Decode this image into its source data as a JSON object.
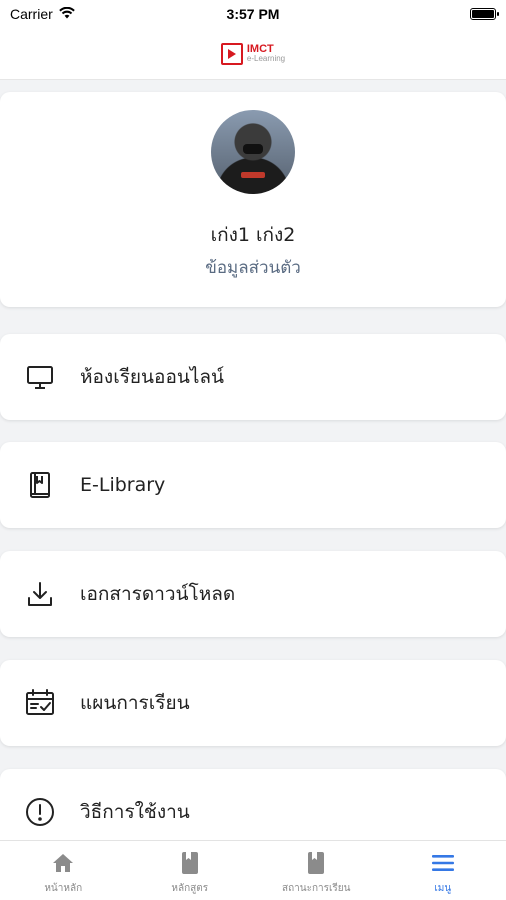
{
  "status_bar": {
    "carrier": "Carrier",
    "time": "3:57 PM"
  },
  "header": {
    "logo_title": "IMCT",
    "logo_subtitle": "e-Learning",
    "brand_color": "#d71920"
  },
  "profile": {
    "name": "เก่ง1 เก่ง2",
    "link_label": "ข้อมูลส่วนตัว"
  },
  "menu": {
    "items": [
      {
        "label": "ห้องเรียนออนไลน์",
        "icon": "monitor-icon"
      },
      {
        "label": "E-Library",
        "icon": "book-icon"
      },
      {
        "label": "เอกสารดาวน์โหลด",
        "icon": "download-icon"
      },
      {
        "label": "แผนการเรียน",
        "icon": "calendar-check-icon"
      },
      {
        "label": "วิธีการใช้งาน",
        "icon": "info-icon"
      }
    ]
  },
  "tabs": {
    "items": [
      {
        "label": "หน้าหลัก",
        "icon": "home-icon"
      },
      {
        "label": "หลักสูตร",
        "icon": "book-icon"
      },
      {
        "label": "สถานะการเรียน",
        "icon": "book-icon"
      },
      {
        "label": "เมนู",
        "icon": "hamburger-menu-icon"
      }
    ],
    "active_index": 3,
    "active_color": "#3578e5",
    "inactive_color": "#8b8b8b"
  }
}
